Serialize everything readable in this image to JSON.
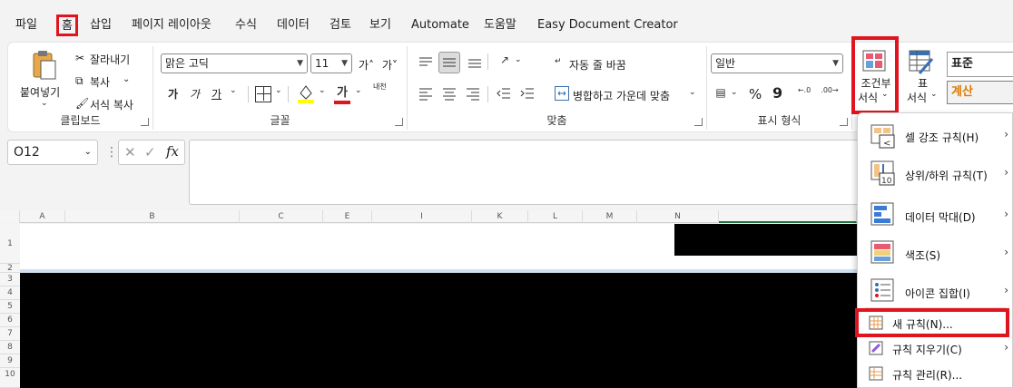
{
  "tabs": [
    "파일",
    "홈",
    "삽입",
    "페이지 레이아웃",
    "수식",
    "데이터",
    "검토",
    "보기",
    "Automate",
    "도움말",
    "Easy Document Creator"
  ],
  "clipboard": {
    "paste": "붙여넣기",
    "cut": "잘라내기",
    "copy": "복사",
    "format_painter": "서식 복사",
    "label": "클립보드"
  },
  "font": {
    "name": "맑은 고딕",
    "size": "11",
    "grow": "가˄",
    "shrink": "가˅",
    "bold": "가",
    "italic": "가",
    "underline": "가",
    "font_color_glyph": "가",
    "phonetic": "내천",
    "label": "글꼴"
  },
  "alignment": {
    "wrap": "자동 줄 바꿈",
    "merge": "병합하고 가운데 맞춤",
    "label": "맞춤"
  },
  "number": {
    "format": "일반",
    "percent": "%",
    "comma": "9",
    "label": "표시 형식"
  },
  "styles": {
    "conditional": "조건부 서식",
    "conditional_line1": "조건부",
    "conditional_line2": "서식",
    "table_line1": "표",
    "table_line2": "서식",
    "style_normal": "표준",
    "style_calc": "계산"
  },
  "namebox": "O12",
  "fx": "fx",
  "columns": [
    "A",
    "B",
    "C",
    "E",
    "I",
    "K",
    "L",
    "M",
    "N"
  ],
  "rows": [
    "1",
    "2",
    "3",
    "4",
    "5",
    "6",
    "7",
    "8",
    "9",
    "10"
  ],
  "menu": {
    "items": [
      {
        "label": "셀 강조 규칙(H)",
        "submenu": true
      },
      {
        "label": "상위/하위 규칙(T)",
        "submenu": true
      },
      {
        "label": "데이터 막대(D)",
        "submenu": true
      },
      {
        "label": "색조(S)",
        "submenu": true
      },
      {
        "label": "아이콘 집합(I)",
        "submenu": true
      },
      {
        "label": "새 규칙(N)...",
        "submenu": false
      },
      {
        "label": "규칙 지우기(C)",
        "submenu": true
      },
      {
        "label": "규칙 관리(R)...",
        "submenu": false
      }
    ],
    "icon_num": "10"
  },
  "colors": {
    "accent_red": "#e0141e",
    "calc_orange": "#e07b00"
  }
}
